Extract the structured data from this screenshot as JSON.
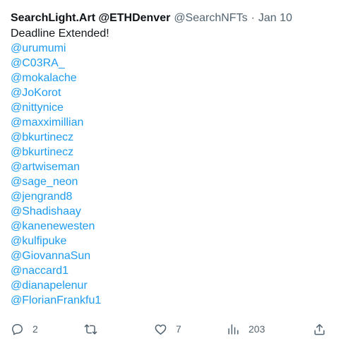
{
  "tweet": {
    "author_name": "SearchLight.Art @ETHDenver",
    "handle": "@SearchNFTs",
    "separator": "·",
    "date": "Jan 10",
    "text": "Deadline Extended!",
    "mentions": [
      "@urumumi",
      "@C03RA_",
      "@mokalache",
      "@JoKorot",
      "@nittynice",
      "@maxximillian",
      "@bkurtinecz",
      "@bkurtinecz",
      "@artwiseman",
      "@sage_neon",
      "@jengrand8",
      "@Shadishaay",
      "@kanenewesten",
      "@kulfipuke",
      "@GiovannaSun",
      "@naccard1",
      "@dianapelenur",
      "@FlorianFrankfu1"
    ]
  },
  "actions": {
    "replies": "2",
    "retweets": "",
    "likes": "7",
    "views": "203",
    "icons": [
      "reply-icon",
      "retweet-icon",
      "like-icon",
      "views-icon",
      "share-icon"
    ]
  },
  "colors": {
    "text": "#0f1419",
    "muted": "#536471",
    "link": "#1d9bf0",
    "background": "#ffffff"
  }
}
